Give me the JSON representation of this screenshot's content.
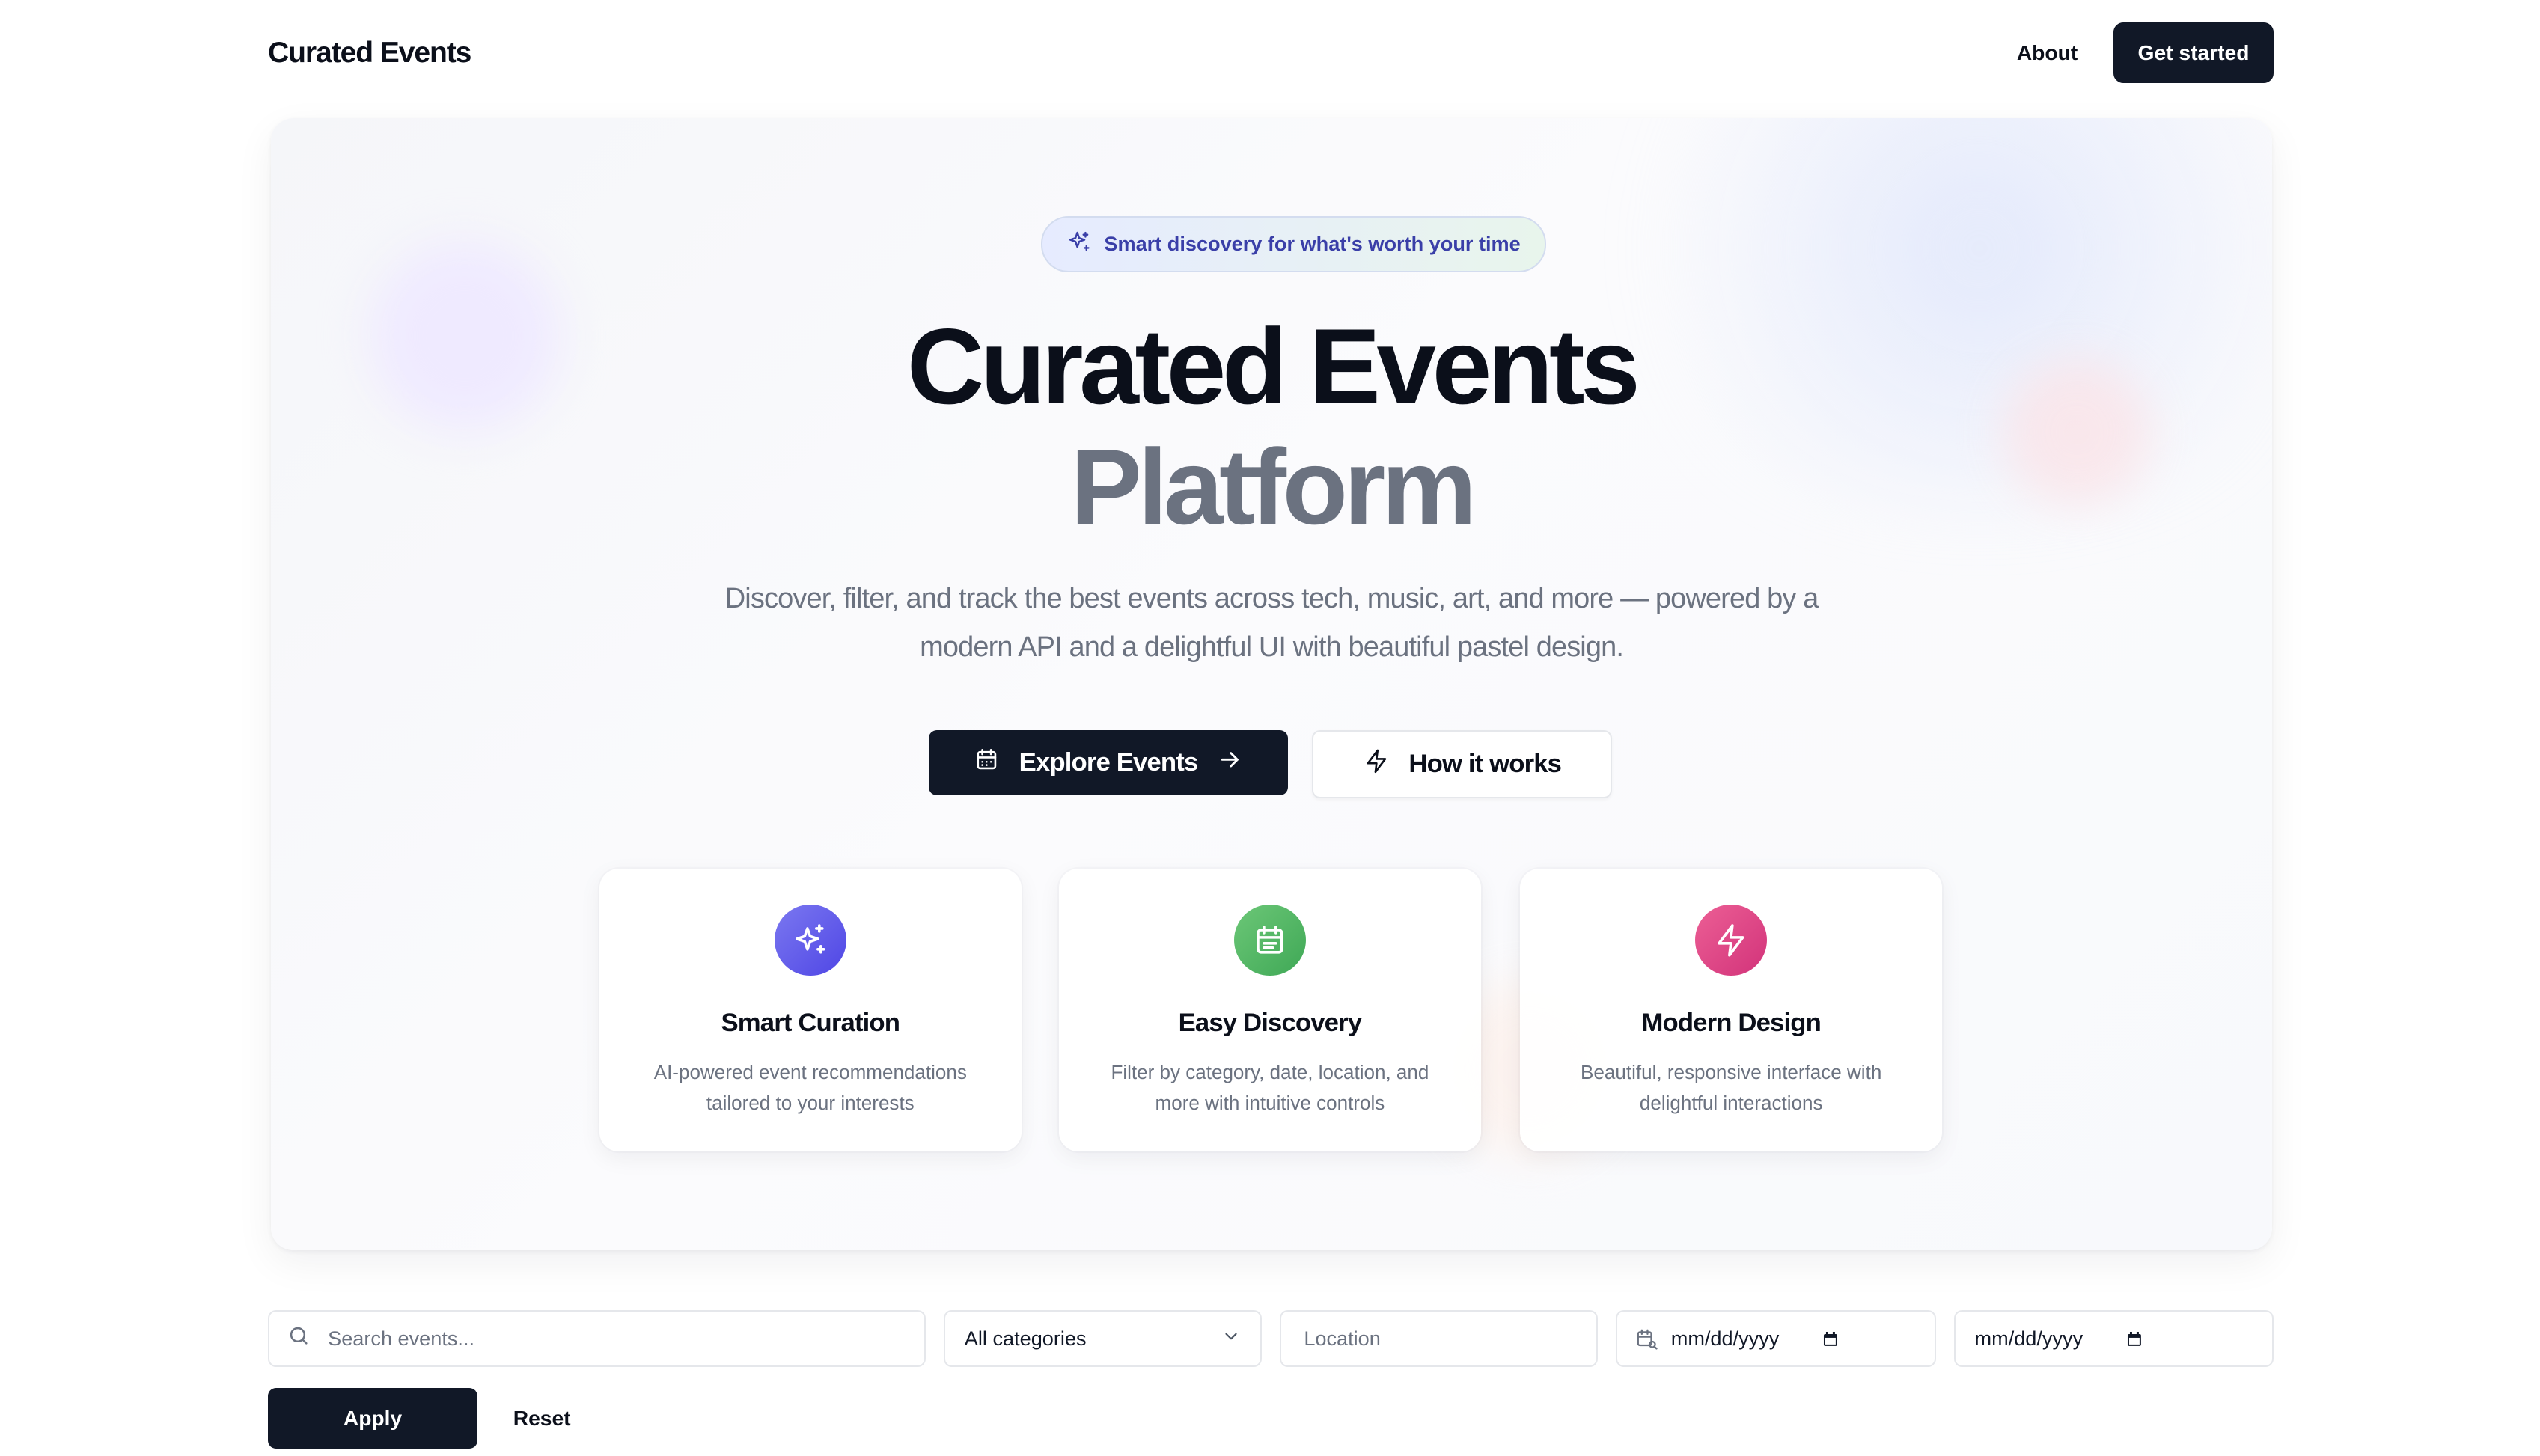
{
  "header": {
    "brand": "Curated Events",
    "nav_about": "About",
    "get_started": "Get started"
  },
  "hero": {
    "badge": "Smart discovery for what's worth your time",
    "title_line1": "Curated Events",
    "title_line2": "Platform",
    "subtitle": "Discover, filter, and track the best events across tech, music, art, and more — powered by a modern API and a delightful UI with beautiful pastel design.",
    "cta_primary": "Explore Events",
    "cta_secondary": "How it works"
  },
  "features": [
    {
      "title": "Smart Curation",
      "description": "AI-powered event recommendations tailored to your interests",
      "icon": "sparkles-icon",
      "color": "#5b55e8"
    },
    {
      "title": "Easy Discovery",
      "description": "Filter by category, date, location, and more with intuitive controls",
      "icon": "calendar-icon",
      "color": "#4cb462"
    },
    {
      "title": "Modern Design",
      "description": "Beautiful, responsive interface with delightful interactions",
      "icon": "lightning-icon",
      "color": "#de4585"
    }
  ],
  "filters": {
    "search_placeholder": "Search events...",
    "category_selected": "All categories",
    "location_placeholder": "Location",
    "date_from": "mm/dd/yyyy",
    "date_to": "mm/dd/yyyy",
    "apply": "Apply",
    "reset": "Reset"
  }
}
